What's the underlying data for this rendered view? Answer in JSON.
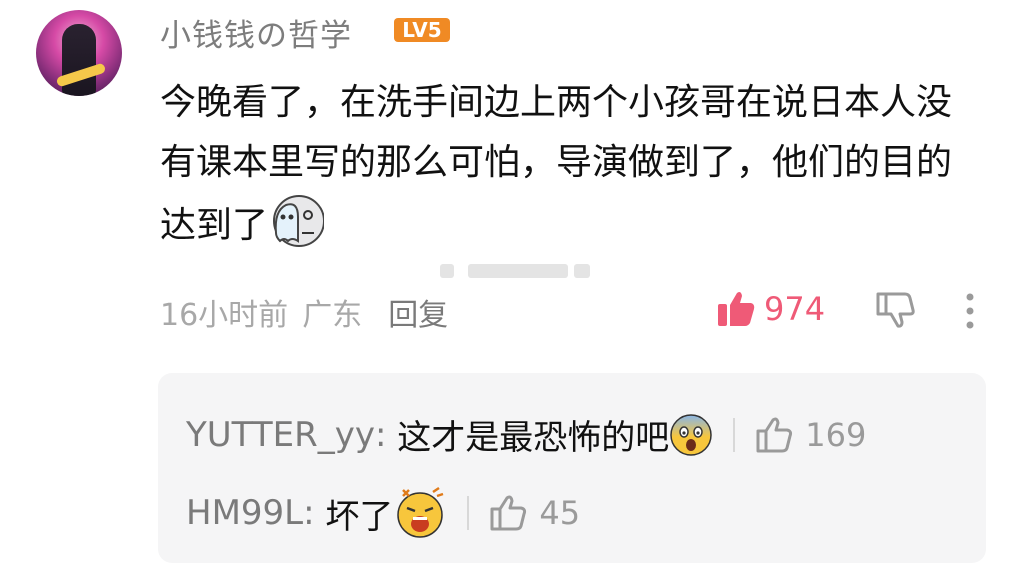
{
  "comment": {
    "username": "小钱钱の哲学",
    "level": "LV5",
    "text": "今晚看了，在洗手间边上两个小孩哥在说日本人没有课本里写的那么可怕，导演做到了，他们的目的达到了",
    "time": "16小时前",
    "location": "广东",
    "reply_label": "回复",
    "likes": "974",
    "like_color": "#ef5a77",
    "emoji": "ghost-face-emoji"
  },
  "replies": [
    {
      "name": "YUTTER_yy",
      "text": "这才是最恐怖的吧",
      "emoji": "screaming-face-emoji",
      "likes": "169"
    },
    {
      "name": "HM99L",
      "text": "坏了",
      "emoji": "shocked-face-emoji",
      "likes": "45"
    }
  ]
}
